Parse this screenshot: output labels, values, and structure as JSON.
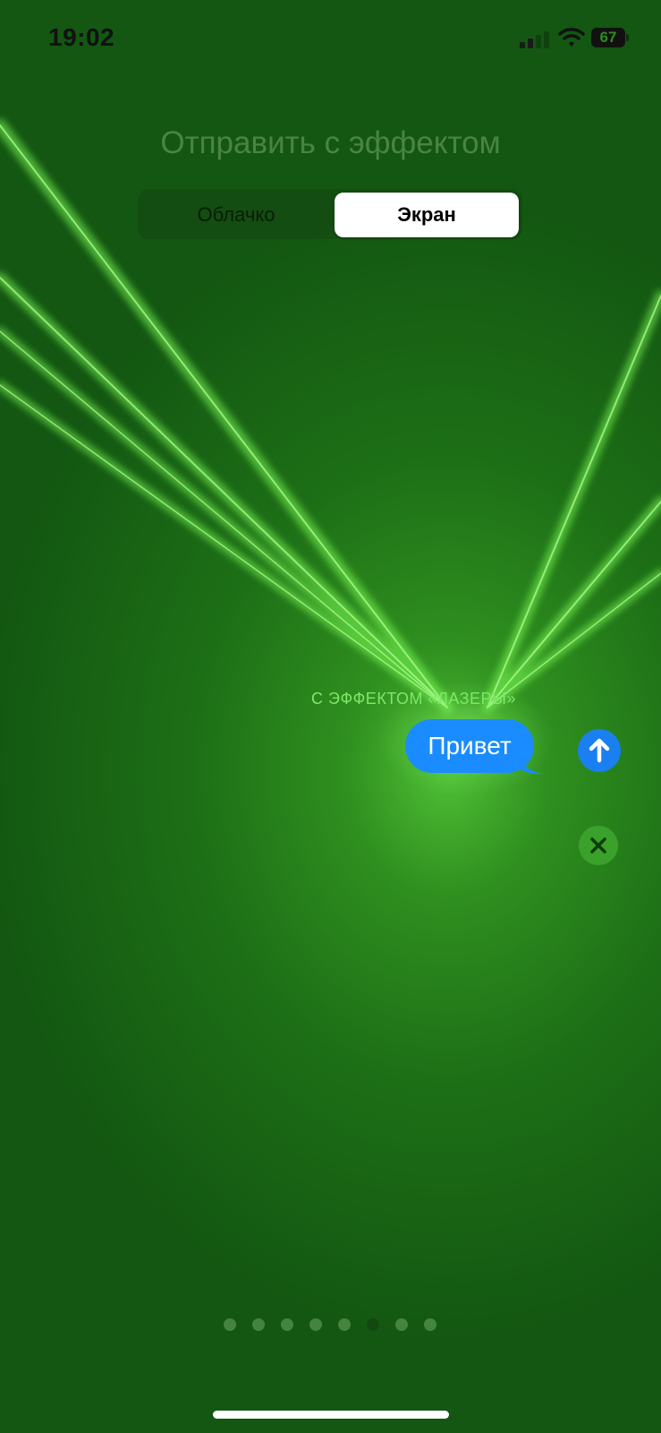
{
  "status_bar": {
    "time": "19:02",
    "battery_percent": "67",
    "signal_bars_active": 2,
    "signal_bars_total": 4
  },
  "header": {
    "title": "Отправить с эффектом"
  },
  "segmented_control": {
    "options": [
      "Облачко",
      "Экран"
    ],
    "selected": "Экран"
  },
  "effect": {
    "label": "С ЭФФЕКТОМ «ЛАЗЕРЫ»"
  },
  "message": {
    "text": "Привет"
  },
  "buttons": {
    "send_icon": "arrow-up-icon",
    "cancel_icon": "close-icon"
  },
  "pager": {
    "total": 8,
    "active_index": 5
  },
  "colors": {
    "background": "#1d6f16",
    "laser": "#8dff6a",
    "bubble": "#1a8cff",
    "send_button": "#1a7ff0"
  }
}
